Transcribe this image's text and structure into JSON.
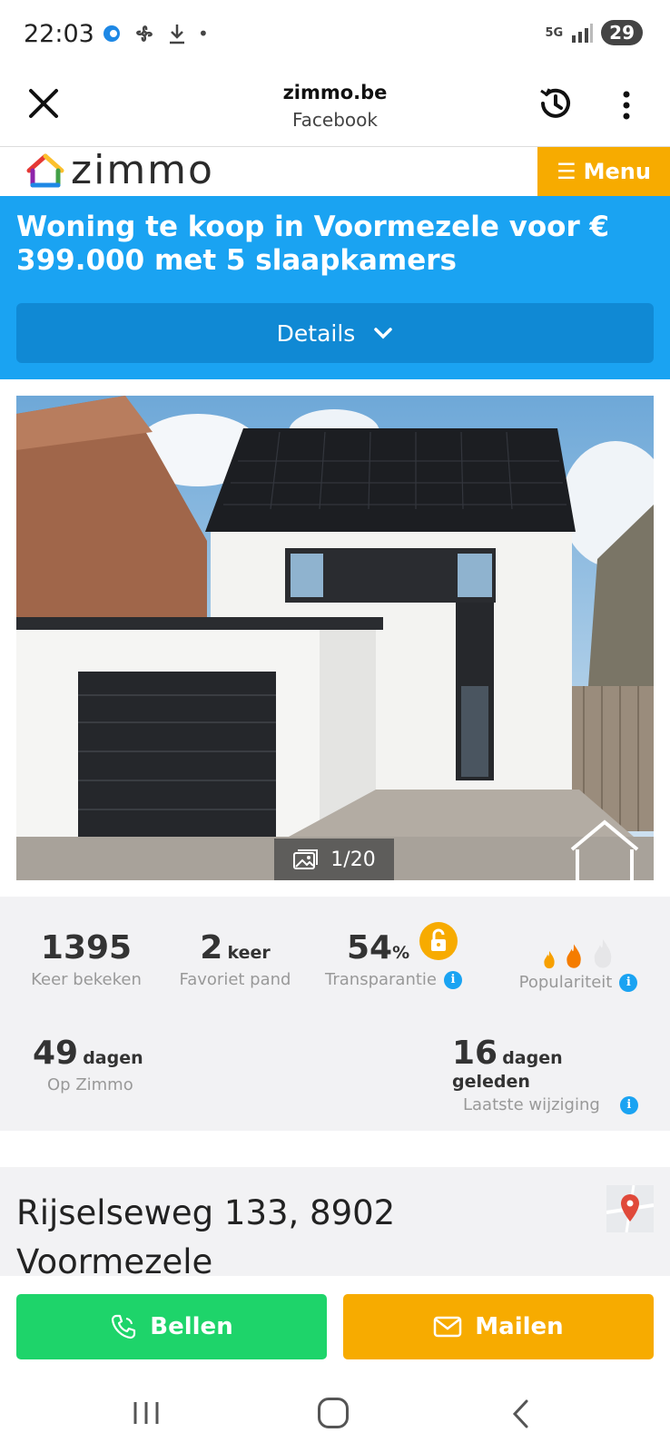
{
  "status_bar": {
    "time": "22:03",
    "network": "5G",
    "battery": "29"
  },
  "browser": {
    "domain": "zimmo.be",
    "source": "Facebook"
  },
  "site": {
    "logo_text": "zimmo",
    "menu_label": "Menu"
  },
  "listing": {
    "title": "Woning te koop in Voormezele voor € 399.000 met 5 slaapkamers",
    "details_label": "Details",
    "photo_counter": "1/20",
    "address": "Rijselseweg 133, 8902 Voormezele"
  },
  "stats": {
    "views": {
      "value": "1395",
      "label": "Keer bekeken"
    },
    "favorites": {
      "value": "2",
      "unit": "keer",
      "label": "Favoriet pand"
    },
    "transparency": {
      "value": "54",
      "unit": "%",
      "label": "Transparantie"
    },
    "popularity": {
      "label": "Populariteit",
      "level": 2,
      "max": 3
    },
    "on_zimmo": {
      "value": "49",
      "unit": "dagen",
      "label": "Op Zimmo"
    },
    "last_change": {
      "value": "16",
      "unit": "dagen geleden",
      "label": "Laatste wijziging"
    }
  },
  "actions": {
    "call_label": "Bellen",
    "mail_label": "Mailen"
  },
  "colors": {
    "accent_blue": "#1aa3f2",
    "accent_orange": "#f7ab00",
    "call_green": "#1ed46a"
  }
}
